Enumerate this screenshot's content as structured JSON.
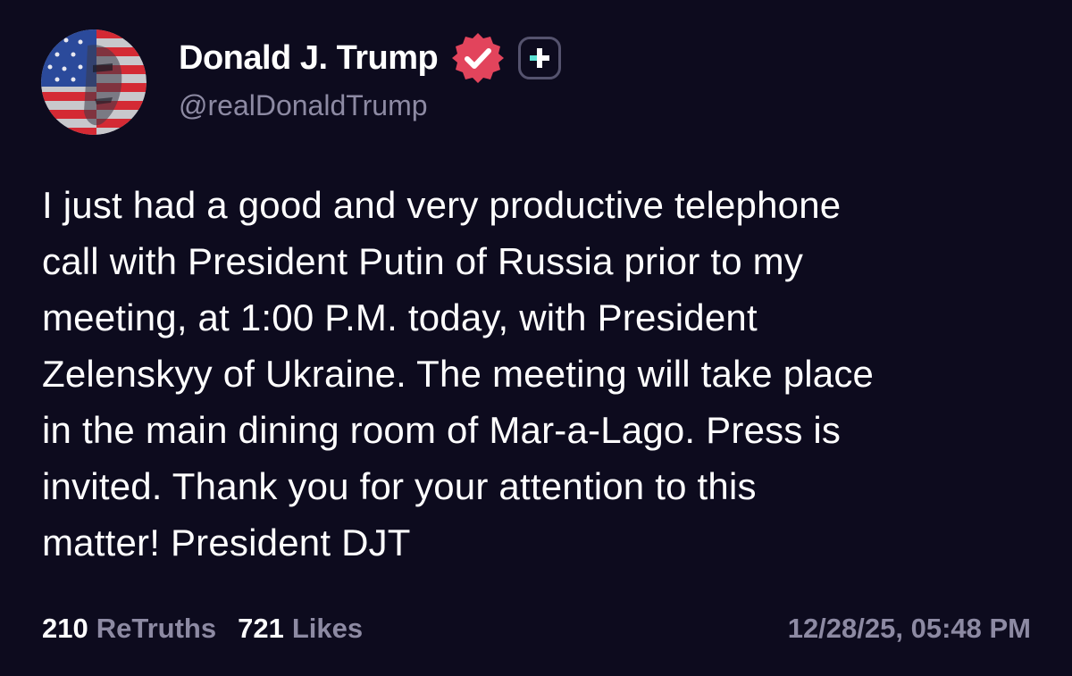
{
  "post": {
    "author": {
      "display_name": "Donald J. Trump",
      "handle": "@realDonaldTrump",
      "verified_icon": "verified-badge-icon",
      "follow_icon": "plus-icon"
    },
    "body_lines": [
      "I just had a good and very productive telephone",
      "call with President Putin of Russia prior to my",
      "meeting, at 1:00 P.M. today, with President",
      "Zelenskyy of Ukraine. The meeting will take place",
      "in the main dining room of Mar-a-Lago. Press is",
      "invited. Thank you for your attention to this",
      "matter! President DJT"
    ],
    "stats": {
      "retruths_count": "210",
      "retruths_label": "ReTruths",
      "likes_count": "721",
      "likes_label": "Likes"
    },
    "timestamp": "12/28/25, 05:48 PM"
  },
  "colors": {
    "background": "#0d0b1e",
    "primary_text": "#ffffff",
    "secondary_text": "#8d8aa3",
    "verified_badge": "#e2445c",
    "plus_accent": "#5ce1d4"
  }
}
